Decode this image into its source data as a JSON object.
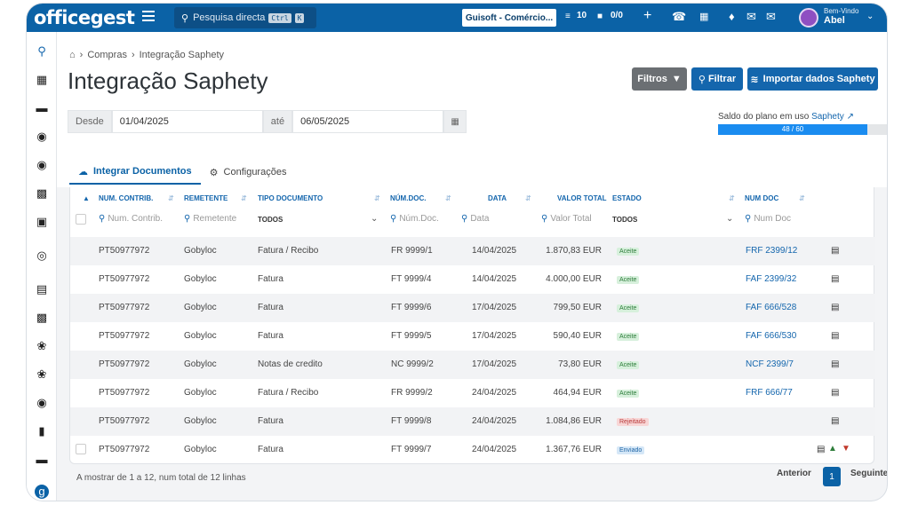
{
  "topbar": {
    "logo": "officegest",
    "search_placeholder": "Pesquisa directa",
    "shortcut_ctrl": "Ctrl",
    "shortcut_k": "K",
    "company": "Guisoft - Comércio...",
    "count_tasks": "10",
    "count_docs": "0/0",
    "welcome": "Bem-Vindo",
    "user": "Abel"
  },
  "breadcrumb": {
    "parent": "Compras",
    "current": "Integração Saphety"
  },
  "page_title": "Integração Saphety",
  "buttons": {
    "filtros": "Filtros",
    "filtrar": "Filtrar",
    "importar": "Importar dados Saphety"
  },
  "dates": {
    "from_label": "Desde",
    "from_value": "01/04/2025",
    "to_label": "até",
    "to_value": "06/05/2025"
  },
  "plan": {
    "label": "Saldo do plano em uso",
    "link": "Saphety",
    "progress_text": "48 / 60",
    "used": 48,
    "total": 60
  },
  "tabs": {
    "integrar": "Integrar Documentos",
    "config": "Configurações"
  },
  "columns": {
    "contrib": "NUM. CONTRIB.",
    "remetente": "REMETENTE",
    "tipo": "TIPO DOCUMENTO",
    "numdoc": "NÚM.DOC.",
    "data": "DATA",
    "valor": "VALOR TOTAL",
    "estado": "ESTADO",
    "numdoc2": "NUM DOC"
  },
  "filters": {
    "contrib": "Num. Contrib.",
    "remetente": "Remetente",
    "tipo": "TODOS",
    "numdoc": "Núm.Doc.",
    "data": "Data",
    "valor": "Valor Total",
    "estado": "TODOS",
    "numdoc2": "Num Doc"
  },
  "rows": [
    {
      "contrib": "PT50977972",
      "remetente": "Gobyloc",
      "tipo": "Fatura / Recibo",
      "numdoc": "FR 9999/1",
      "data": "14/04/2025",
      "valor": "1.870,83 EUR",
      "estado": "Aceite",
      "numdoc2": "FRF 2399/12"
    },
    {
      "contrib": "PT50977972",
      "remetente": "Gobyloc",
      "tipo": "Fatura",
      "numdoc": "FT 9999/4",
      "data": "14/04/2025",
      "valor": "4.000,00 EUR",
      "estado": "Aceite",
      "numdoc2": "FAF 2399/32"
    },
    {
      "contrib": "PT50977972",
      "remetente": "Gobyloc",
      "tipo": "Fatura",
      "numdoc": "FT 9999/6",
      "data": "17/04/2025",
      "valor": "799,50 EUR",
      "estado": "Aceite",
      "numdoc2": "FAF 666/528"
    },
    {
      "contrib": "PT50977972",
      "remetente": "Gobyloc",
      "tipo": "Fatura",
      "numdoc": "FT 9999/5",
      "data": "17/04/2025",
      "valor": "590,40 EUR",
      "estado": "Aceite",
      "numdoc2": "FAF 666/530"
    },
    {
      "contrib": "PT50977972",
      "remetente": "Gobyloc",
      "tipo": "Notas de credito",
      "numdoc": "NC 9999/2",
      "data": "17/04/2025",
      "valor": "73,80 EUR",
      "estado": "Aceite",
      "numdoc2": "NCF 2399/7"
    },
    {
      "contrib": "PT50977972",
      "remetente": "Gobyloc",
      "tipo": "Fatura / Recibo",
      "numdoc": "FR 9999/2",
      "data": "24/04/2025",
      "valor": "464,94 EUR",
      "estado": "Aceite",
      "numdoc2": "FRF 666/77"
    },
    {
      "contrib": "PT50977972",
      "remetente": "Gobyloc",
      "tipo": "Fatura",
      "numdoc": "FT 9999/8",
      "data": "24/04/2025",
      "valor": "1.084,86 EUR",
      "estado": "Rejeitado",
      "numdoc2": ""
    },
    {
      "contrib": "PT50977972",
      "remetente": "Gobyloc",
      "tipo": "Fatura",
      "numdoc": "FT 9999/7",
      "data": "24/04/2025",
      "valor": "1.367,76 EUR",
      "estado": "Enviado",
      "numdoc2": ""
    }
  ],
  "footer": {
    "summary": "A mostrar de 1 a 12, num total de 12 linhas",
    "prev": "Anterior",
    "page": "1",
    "next": "Seguinte"
  },
  "colors": {
    "primary": "#0b62a6",
    "accent": "#1466ad",
    "progress": "#1a8cf0"
  }
}
